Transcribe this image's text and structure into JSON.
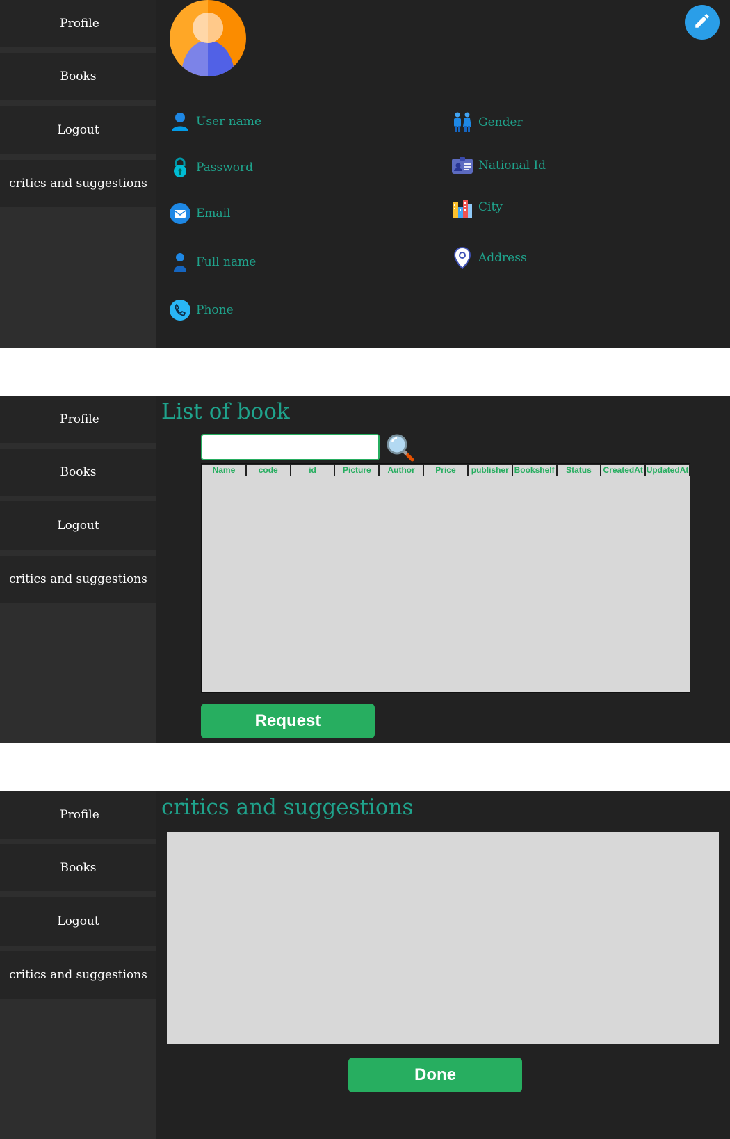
{
  "sidebar": {
    "items": [
      {
        "label": "Profile"
      },
      {
        "label": "Books"
      },
      {
        "label": "Logout"
      },
      {
        "label": "critics and suggestions"
      }
    ]
  },
  "profile": {
    "fields_left": [
      {
        "label": "User name",
        "icon": "user-icon"
      },
      {
        "label": "Password",
        "icon": "lock-icon"
      },
      {
        "label": "Email",
        "icon": "email-icon"
      },
      {
        "label": "Full name",
        "icon": "person-icon"
      },
      {
        "label": "Phone",
        "icon": "phone-icon"
      }
    ],
    "fields_right": [
      {
        "label": "Gender",
        "icon": "gender-icon"
      },
      {
        "label": "National Id",
        "icon": "id-card-icon"
      },
      {
        "label": "City",
        "icon": "city-icon"
      },
      {
        "label": "Address",
        "icon": "location-pin-icon"
      }
    ]
  },
  "books": {
    "title": "List of book",
    "search_value": "",
    "columns": [
      "Name",
      "code",
      "id",
      "Picture",
      "Author",
      "Price",
      "publisher",
      "Bookshelf",
      "Status",
      "CreatedAt",
      "UpdatedAt"
    ],
    "rows": [],
    "request_label": "Request"
  },
  "critics": {
    "title": "critics and suggestions",
    "text_value": "",
    "done_label": "Done"
  },
  "colors": {
    "background": "#222222",
    "sidebar": "#2e2e2e",
    "sidebar_item": "#252525",
    "accent_text": "#1fa38c",
    "button_green": "#27ae60",
    "edit_button": "#2a9ee8",
    "panel_gray": "#d8d8d8"
  }
}
